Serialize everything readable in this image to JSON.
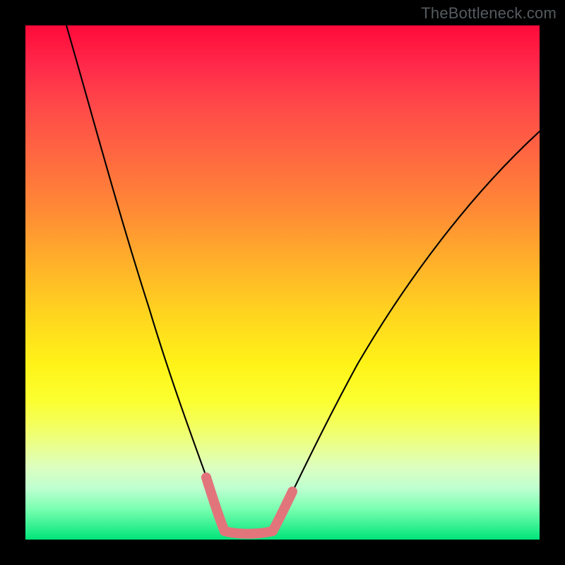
{
  "watermark": "TheBottleneck.com",
  "chart_data": {
    "type": "line",
    "title": "",
    "xlabel": "",
    "ylabel": "",
    "xlim": [
      0,
      100
    ],
    "ylim": [
      0,
      100
    ],
    "grid": false,
    "series": [
      {
        "name": "left-curve",
        "x": [
          8,
          12,
          16,
          20,
          24,
          27,
          30,
          33,
          35,
          37,
          38.5
        ],
        "values": [
          100,
          82,
          66,
          52,
          40,
          30,
          21,
          13,
          8,
          4,
          1.5
        ]
      },
      {
        "name": "right-curve",
        "x": [
          48,
          51,
          55,
          60,
          66,
          73,
          81,
          90,
          100
        ],
        "values": [
          1.5,
          5,
          12,
          21,
          32,
          43,
          55,
          67,
          80
        ]
      },
      {
        "name": "valley-flat",
        "x": [
          38.5,
          48
        ],
        "values": [
          1.5,
          1.5
        ]
      }
    ],
    "markers": [
      {
        "name": "left-segment-highlight",
        "x": [
          35,
          38.5
        ],
        "values": [
          8,
          1.5
        ]
      },
      {
        "name": "right-segment-highlight",
        "x": [
          48,
          51
        ],
        "values": [
          1.5,
          5
        ]
      },
      {
        "name": "valley-highlight",
        "x": [
          38.5,
          48
        ],
        "values": [
          1.5,
          1.5
        ]
      }
    ]
  }
}
